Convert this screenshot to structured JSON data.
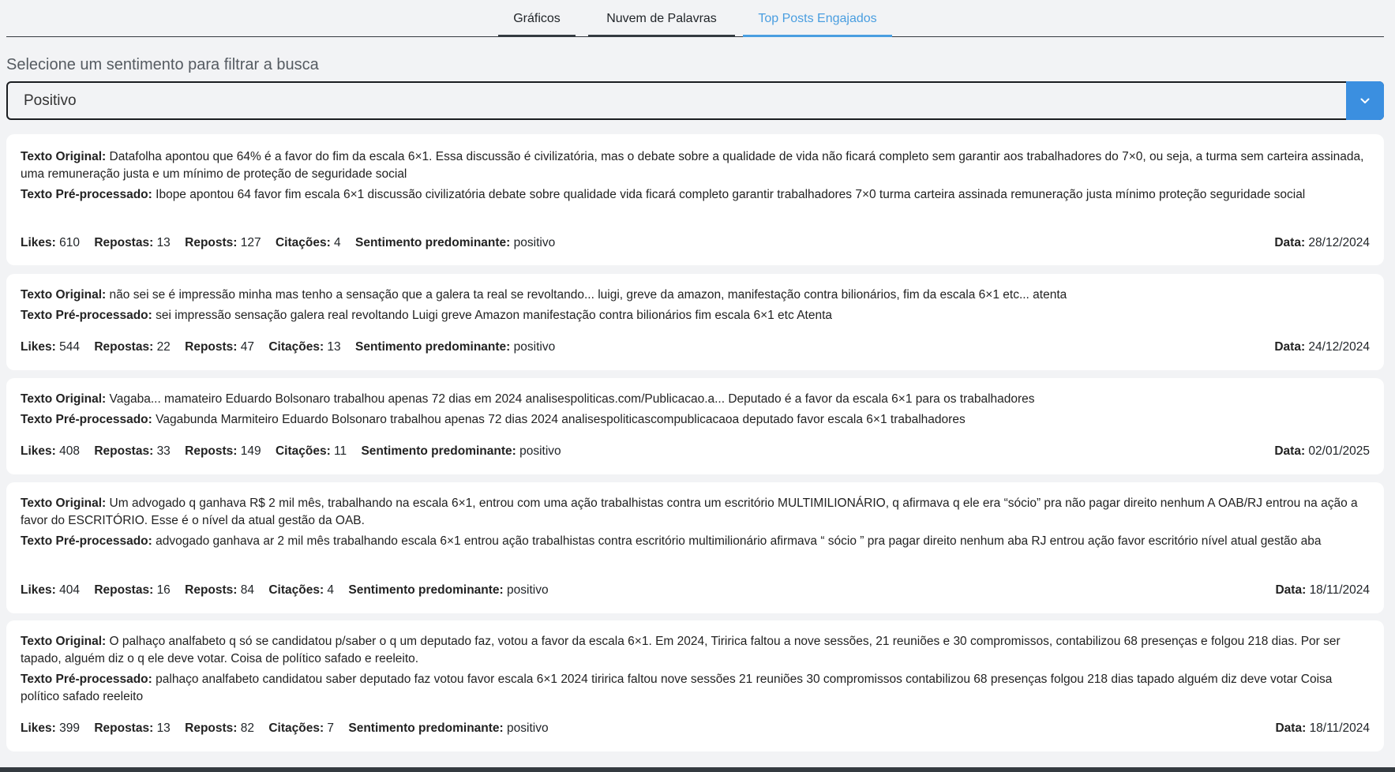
{
  "tabs": [
    "Gráficos",
    "Nuvem de Palavras",
    "Top Posts Engajados"
  ],
  "active_tab": "Top Posts Engajados",
  "filter": {
    "label": "Selecione um sentimento para filtrar a busca",
    "selected": "Positivo"
  },
  "labels": {
    "original": "Texto Original:",
    "preprocessed": "Texto Pré-processado:",
    "likes": "Likes:",
    "replies": "Repostas:",
    "reposts": "Reposts:",
    "quotes": "Citações:",
    "sentiment": "Sentimento predominante:",
    "date": "Data:"
  },
  "posts": [
    {
      "original": "Datafolha apontou que 64% é a favor do fim da escala 6×1. Essa discussão é civilizatória, mas o debate sobre a qualidade de vida não ficará completo sem garantir aos trabalhadores do 7×0, ou seja, a turma sem carteira assinada, uma remuneração justa e um mínimo de proteção de seguridade social",
      "preprocessed": "Ibope apontou 64 favor fim escala 6×1 discussão civilizatória debate sobre qualidade vida ficará completo garantir trabalhadores 7×0 turma carteira assinada remuneração justa mínimo proteção seguridade social",
      "likes": "610",
      "replies": "13",
      "reposts": "127",
      "quotes": "4",
      "sentiment": "positivo",
      "date": "28/12/2024"
    },
    {
      "original": "não sei se é impressão minha mas tenho a sensação que a galera ta real se revoltando... luigi, greve da amazon, manifestação contra bilionários, fim da escala 6×1 etc... atenta",
      "preprocessed": "sei impressão sensação galera real revoltando Luigi greve Amazon manifestação contra bilionários fim escala 6×1 etc Atenta",
      "likes": "544",
      "replies": "22",
      "reposts": "47",
      "quotes": "13",
      "sentiment": "positivo",
      "date": "24/12/2024"
    },
    {
      "original": "Vagaba... mamateiro Eduardo Bolsonaro trabalhou apenas 72 dias em 2024 analisespoliticas.com/Publicacao.a... Deputado é a favor da escala 6×1 para os trabalhadores",
      "preprocessed": "Vagabunda Marmiteiro Eduardo Bolsonaro trabalhou apenas 72 dias 2024 analisespoliticascompublicacaoa deputado favor escala 6×1 trabalhadores",
      "likes": "408",
      "replies": "33",
      "reposts": "149",
      "quotes": "11",
      "sentiment": "positivo",
      "date": "02/01/2025"
    },
    {
      "original": "Um advogado q ganhava R$ 2 mil mês, trabalhando na escala 6×1, entrou com uma ação trabalhistas contra um escritório MULTIMILIONÁRIO, q afirmava q ele era “sócio” pra não pagar direito nenhum A OAB/RJ entrou na ação a favor do ESCRITÓRIO. Esse é o nível da atual gestão da OAB.",
      "preprocessed": "advogado ganhava ar 2 mil mês trabalhando escala 6×1 entrou ação trabalhistas contra escritório multimilionário afirmava “ sócio ” pra pagar direito nenhum aba RJ entrou ação favor escritório nível atual gestão aba",
      "likes": "404",
      "replies": "16",
      "reposts": "84",
      "quotes": "4",
      "sentiment": "positivo",
      "date": "18/11/2024"
    },
    {
      "original": "O palhaço analfabeto q só se candidatou p/saber o q um deputado faz, votou a favor da escala 6×1. Em 2024, Tiririca faltou a nove sessões, 21 reuniões e 30 compromissos, contabilizou 68 presenças e folgou 218 dias. Por ser tapado, alguém diz o q ele deve votar. Coisa de político safado e reeleito.",
      "preprocessed": "palhaço analfabeto candidatou saber deputado faz votou favor escala 6×1 2024 tiririca faltou nove sessões 21 reuniões 30 compromissos contabilizou 68 presenças folgou 218 dias tapado alguém diz deve votar Coisa político safado reeleito",
      "likes": "399",
      "replies": "13",
      "reposts": "82",
      "quotes": "7",
      "sentiment": "positivo",
      "date": "18/11/2024"
    }
  ]
}
